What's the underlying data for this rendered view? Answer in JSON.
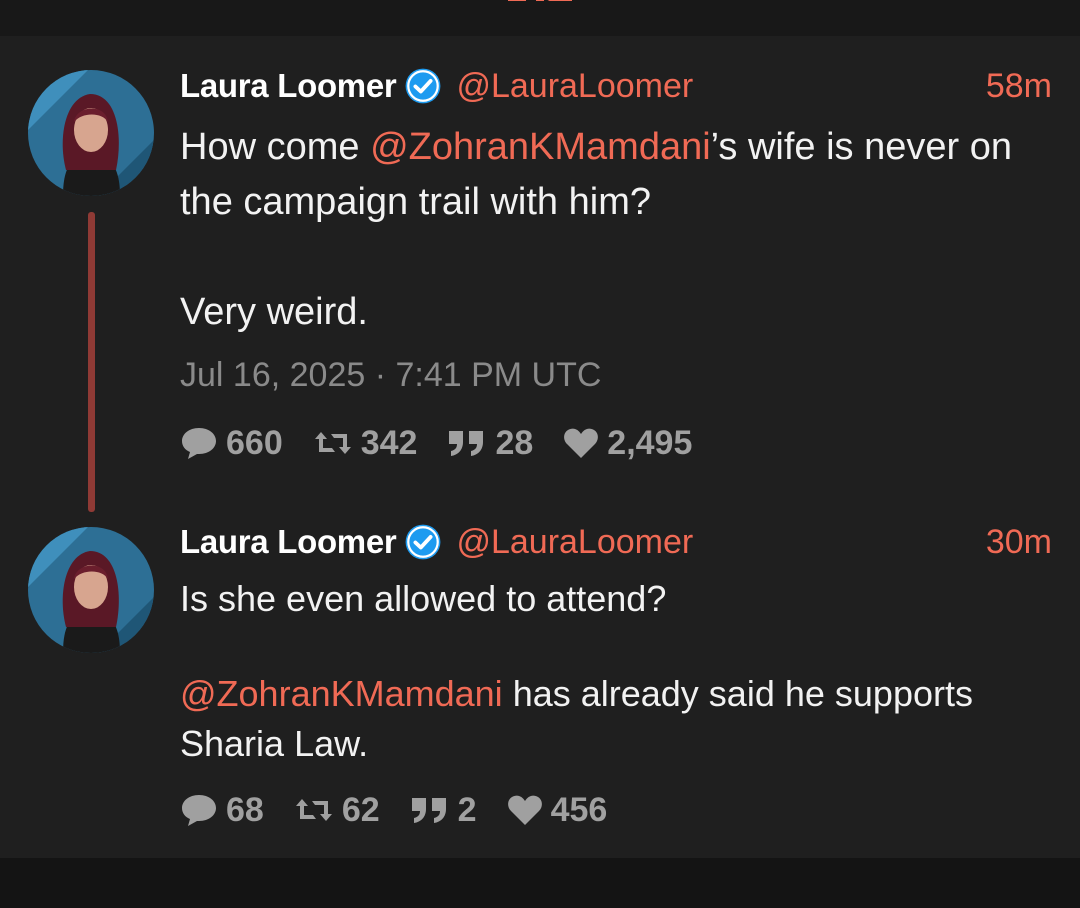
{
  "colors": {
    "accent": "#f06a55",
    "thread_line": "#8f3a35",
    "verified": "#1d9bf0",
    "background": "#1f1f1f"
  },
  "tweets": [
    {
      "author": {
        "name": "Laura Loomer",
        "handle": "@LauraLoomer",
        "verified_icon": "verified-badge-icon"
      },
      "age": "58m",
      "text": {
        "mention": "@ZohranKMamdani",
        "before_mention": "How come ",
        "after_mention": "’s wife is never on the campaign trail with him?",
        "paragraph2": "Very weird."
      },
      "date": "Jul 16, 2025 · 7:41 PM UTC",
      "stats": {
        "replies": "660",
        "retweets": "342",
        "quotes": "28",
        "likes": "2,495"
      }
    },
    {
      "author": {
        "name": "Laura Loomer",
        "handle": "@LauraLoomer",
        "verified_icon": "verified-badge-icon"
      },
      "age": "30m",
      "text": {
        "paragraph1": "Is she even allowed to attend?",
        "mention": "@ZohranKMamdani",
        "after_mention": " has already said he supports Sharia Law."
      },
      "stats": {
        "replies": "68",
        "retweets": "62",
        "quotes": "2",
        "likes": "456"
      }
    }
  ],
  "icons": [
    "comment-icon",
    "retweet-icon",
    "quote-icon",
    "heart-icon",
    "verified-badge-icon",
    "nitter-logo-icon"
  ]
}
